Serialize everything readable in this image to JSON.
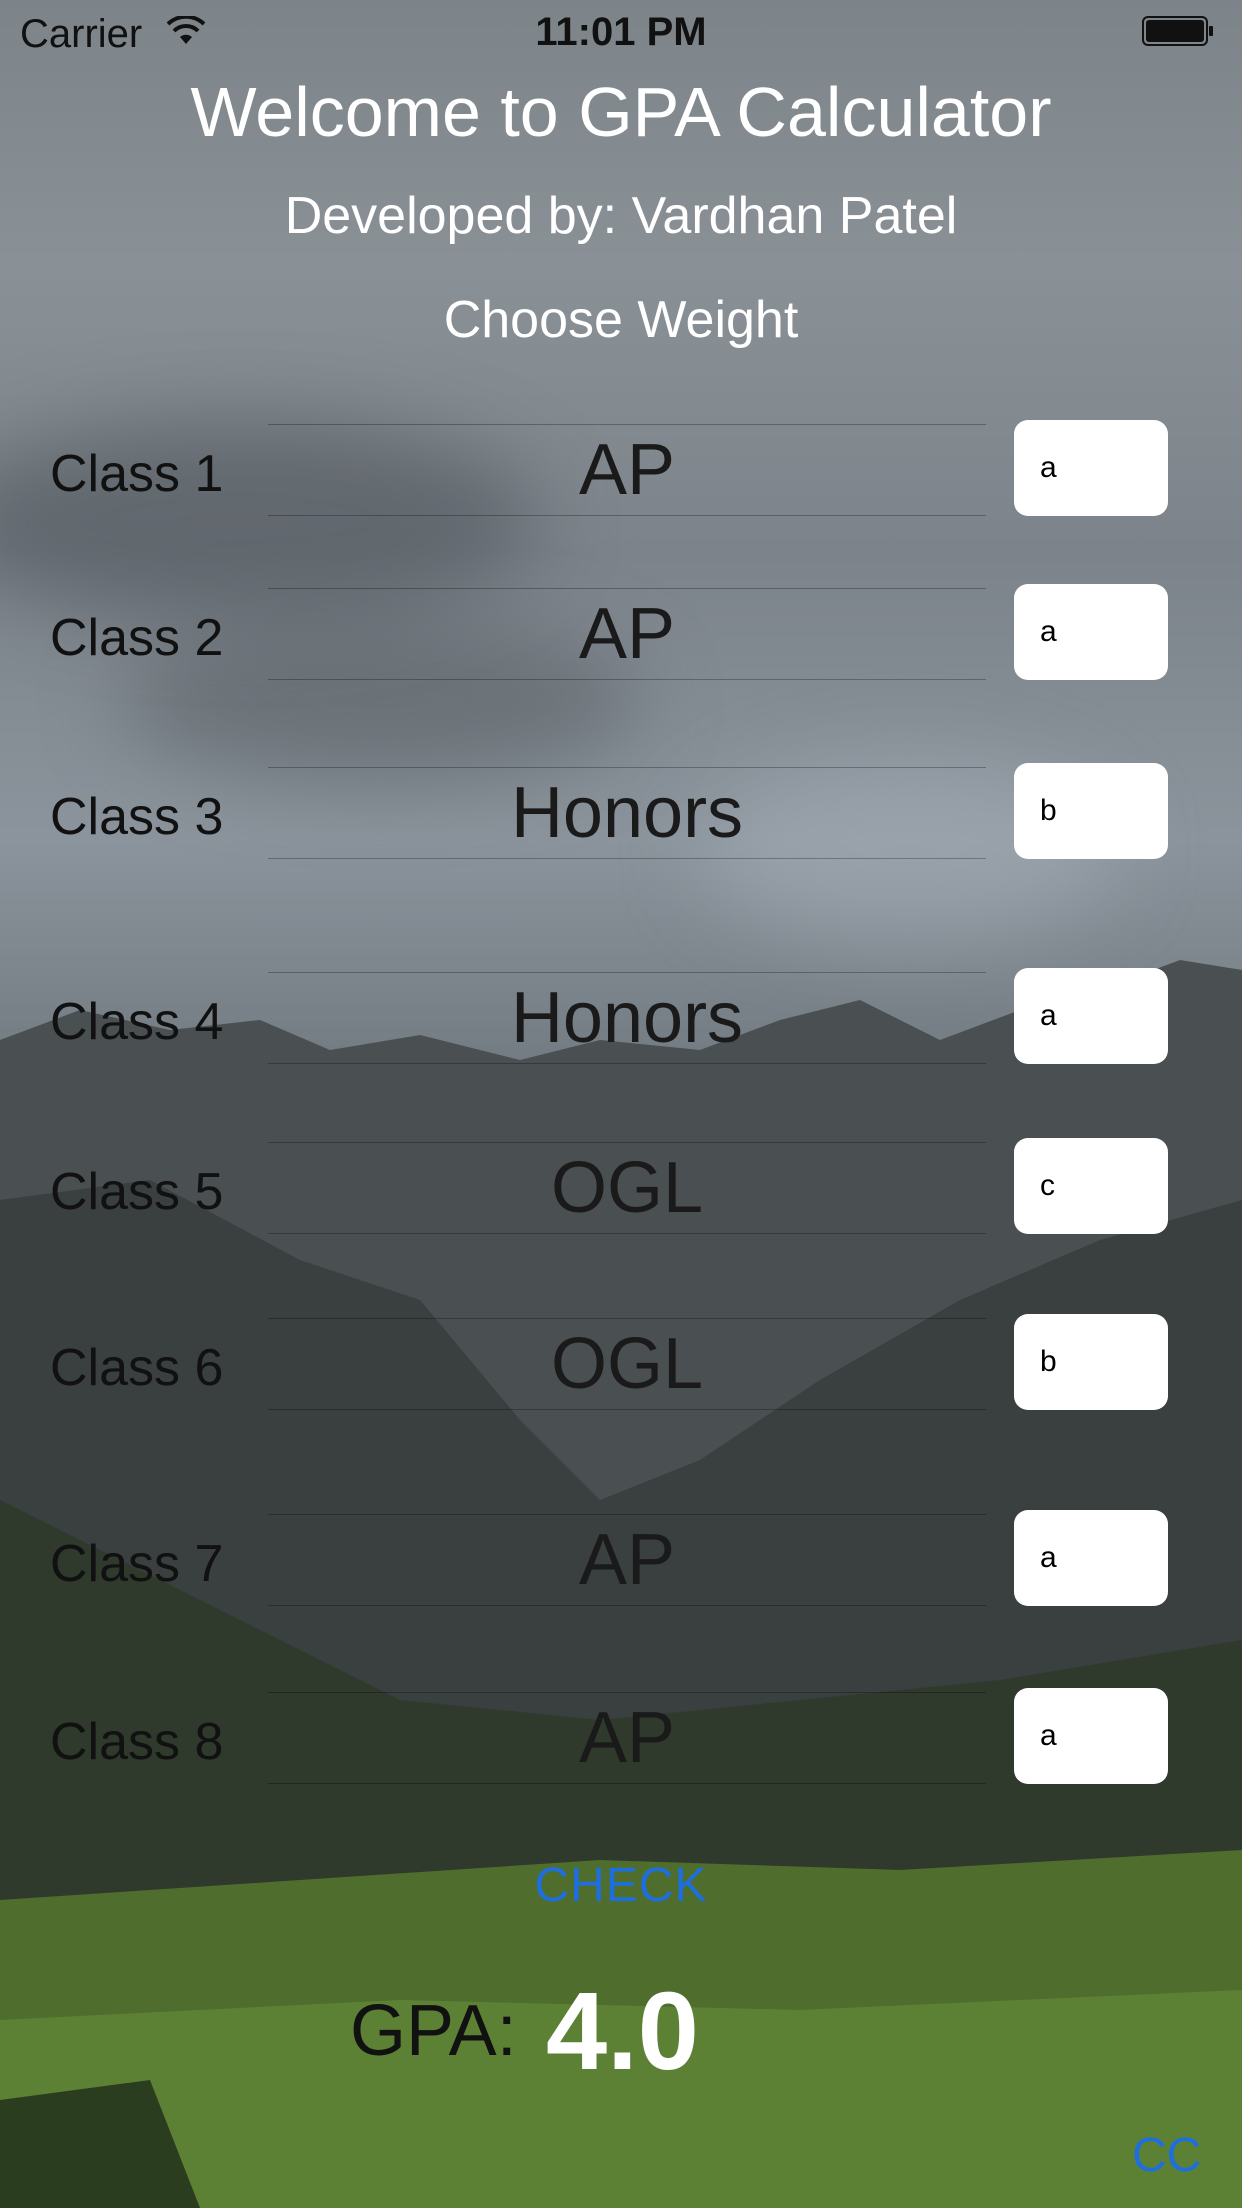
{
  "status_bar": {
    "carrier": "Carrier",
    "time": "11:01 PM"
  },
  "header": {
    "title": "Welcome to GPA Calculator",
    "developer": "Developed by: Vardhan Patel",
    "instruction": "Choose Weight"
  },
  "classes": [
    {
      "label": "Class 1",
      "weight": "AP",
      "grade": "a"
    },
    {
      "label": "Class 2",
      "weight": "AP",
      "grade": "a"
    },
    {
      "label": "Class 3",
      "weight": "Honors",
      "grade": "b"
    },
    {
      "label": "Class 4",
      "weight": "Honors",
      "grade": "a"
    },
    {
      "label": "Class 5",
      "weight": "OGL",
      "grade": "c"
    },
    {
      "label": "Class 6",
      "weight": "OGL",
      "grade": "b"
    },
    {
      "label": "Class 7",
      "weight": "AP",
      "grade": "a"
    },
    {
      "label": "Class 8",
      "weight": "AP",
      "grade": "a"
    }
  ],
  "actions": {
    "check_label": "CHECK",
    "cc_label": "CC"
  },
  "result": {
    "gpa_label": "GPA:",
    "gpa_value": "4.0"
  },
  "colors": {
    "link": "#1d6fe0",
    "text_dark": "#111111"
  },
  "icons": {
    "wifi": "wifi-icon",
    "battery": "battery-icon"
  }
}
